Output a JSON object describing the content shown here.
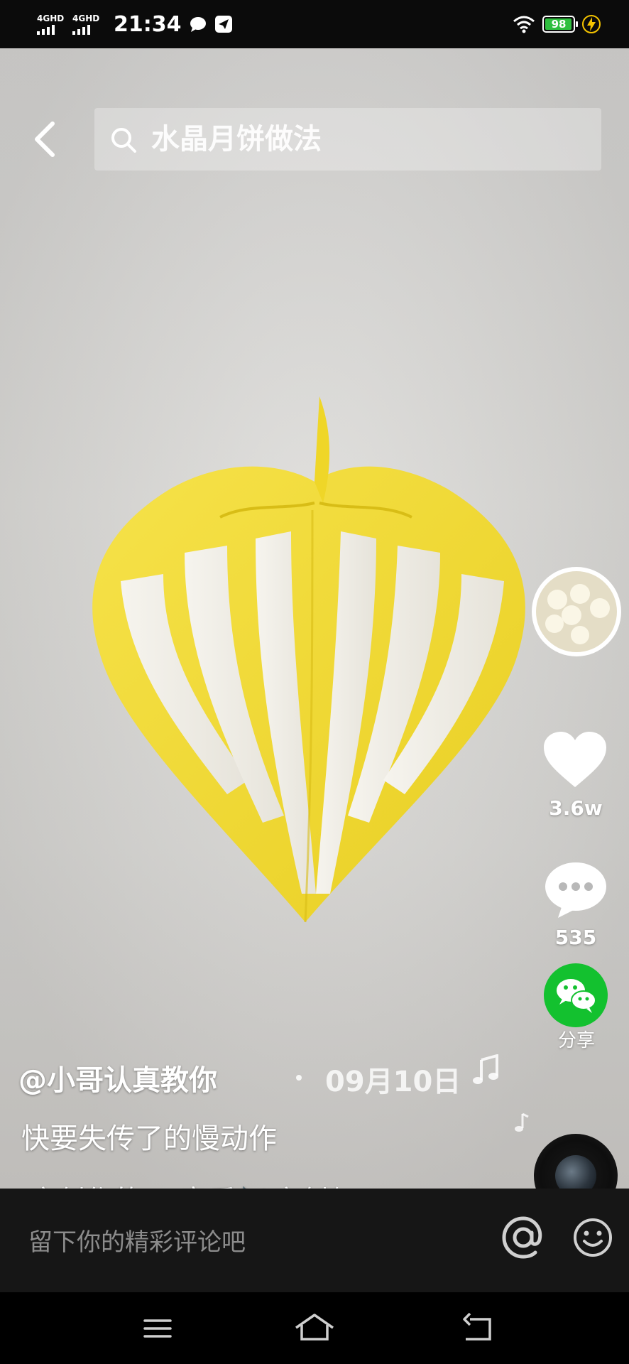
{
  "status_bar": {
    "network1": "4GHD",
    "network2": "4GHD",
    "time": "21:34",
    "battery": "98",
    "battery_level": 0.98
  },
  "search": {
    "query": "水晶月饼做法",
    "icon": "search-icon"
  },
  "back_icon": "chevron-left-icon",
  "actions": {
    "like_count": "3.6w",
    "comment_count": "535",
    "share_label": "分享"
  },
  "caption": {
    "author": "@小哥认真教你",
    "date": "09月10日",
    "description": "快要失传了的慢动作",
    "music_text": "库创作的  @音乐🎶库创作的"
  },
  "comment_bar": {
    "placeholder": "留下你的精彩评论吧"
  },
  "nav": {
    "menu_icon": "menu-icon",
    "home_icon": "home-icon",
    "back_icon": "back-icon"
  },
  "colors": {
    "dough_yellow": "#f2de3a",
    "dough_white": "#f4f2ec",
    "share_green": "#13c12f",
    "battery_green": "#2fbf3f"
  }
}
